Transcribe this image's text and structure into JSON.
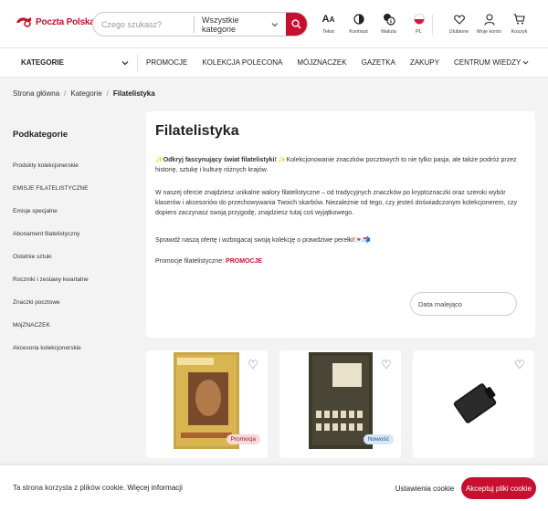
{
  "header": {
    "logo_text": "Poczta Polska",
    "search": {
      "placeholder": "Czego szukasz?",
      "category": "Wszystkie kategorie"
    },
    "tools": [
      {
        "icon": "text-size-icon",
        "label": "Tekst"
      },
      {
        "icon": "contrast-icon",
        "label": "Kontrast"
      },
      {
        "icon": "currency-icon",
        "label": "Waluta"
      },
      {
        "icon": "poland-flag-icon",
        "label": "PL"
      }
    ],
    "user_tools": [
      {
        "icon": "heart-icon",
        "label": "Ulubione"
      },
      {
        "icon": "user-icon",
        "label": "Moje konto"
      },
      {
        "icon": "cart-icon",
        "label": "Koszyk"
      }
    ]
  },
  "nav": {
    "categories_label": "KATEGORIE",
    "items": [
      "PROMOCJE",
      "KOLEKCJA POLECONA",
      "MÓJZNACZEK",
      "GAZETKA",
      "ZAKUPY",
      "CENTRUM WIEDZY"
    ]
  },
  "breadcrumb": {
    "home": "Strona główna",
    "level1": "Kategorie",
    "current": "Filatelistyka"
  },
  "sidebar": {
    "title": "Podkategorie",
    "items": [
      "Produkty kolekcjonerskie",
      "EMISJE FILATELISTYCZNE",
      "Emisje specjalne",
      "Abonament filatelistyczny",
      "Ostatnie sztuki",
      "Roczniki i zestawy kwartalne",
      "Znaczki pocztowe",
      "MójZNACZEK",
      "Akcesoria kolekcjonerskie"
    ]
  },
  "content": {
    "title": "Filatelistyka",
    "intro_bold": "✨Odkryj fascynujący świat filatelistyki! ✨",
    "intro_rest": "Kolekcjonowanie znaczków pocztowych to nie tylko pasja, ale także podróż przez historię, sztukę i kulturę różnych krajów.",
    "para2": "W naszej ofercie znajdziesz unikalne walory filatelistyczne – od tradycyjnych znaczków po kryptoznaczki oraz szeroki wybór klaserów i akcesoriów do przechowywania Twoich skarbów. Niezależnie od tego, czy jesteś doświadczonym kolekcjonerem, czy dopiero zaczynasz swoją przygodę, znajdziesz tutaj coś wyjątkowego.",
    "para3": "Sprawdź naszą ofertę i wzbogacaj swoją kolekcję o prawdziwe perełki!💌📬",
    "promo_prefix": "Promocje filatelistyczne: ",
    "promo_link": "PROMOCJE"
  },
  "sort": {
    "selected": "Data malejąco"
  },
  "products": [
    {
      "badge": "Promocja"
    },
    {
      "badge": "Nowość"
    },
    {
      "badge": ""
    }
  ],
  "cookie": {
    "text": "Ta strona korzysta z plików cookie. ",
    "link": "Więcej informacji",
    "settings": "Ustawienia cookie",
    "accept": "Akceptuj pliki cookie"
  },
  "colors": {
    "brand": "#c8102e"
  }
}
